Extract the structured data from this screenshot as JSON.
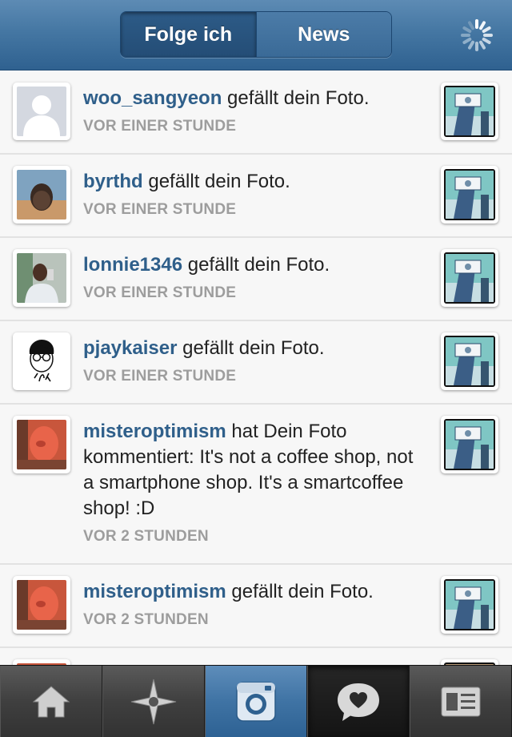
{
  "header": {
    "tabs": [
      {
        "label": "Folge ich",
        "active": true
      },
      {
        "label": "News",
        "active": false
      }
    ],
    "loading_icon": "spinner-icon"
  },
  "activities": [
    {
      "username": "woo_sangyeon",
      "text": " gefällt dein Foto.",
      "time": "VOR EINER STUNDE",
      "avatar": "default-avatar"
    },
    {
      "username": "byrthd",
      "text": " gefällt dein Foto.",
      "time": "VOR EINER STUNDE",
      "avatar": "photo"
    },
    {
      "username": "lonnie1346",
      "text": " gefällt dein Foto.",
      "time": "VOR EINER STUNDE",
      "avatar": "photo"
    },
    {
      "username": "pjaykaiser",
      "text": " gefällt dein Foto.",
      "time": "VOR EINER STUNDE",
      "avatar": "drawing"
    },
    {
      "username": "misteroptimism",
      "text": " hat Dein Foto kommentiert: It's not a coffee shop, not a smartphone shop. It's a smartcoffee shop! :D",
      "time": "VOR 2 STUNDEN",
      "avatar": "photo"
    },
    {
      "username": "misteroptimism",
      "text": " gefällt dein Foto.",
      "time": "VOR 2 STUNDEN",
      "avatar": "photo"
    }
  ],
  "tabbar": {
    "items": [
      {
        "icon": "home-icon"
      },
      {
        "icon": "explore-star-icon"
      },
      {
        "icon": "camera-icon"
      },
      {
        "icon": "activity-heart-bubble-icon"
      },
      {
        "icon": "profile-card-icon"
      }
    ]
  },
  "colors": {
    "header_blue": "#4577a3",
    "username_blue": "#2f5f8a",
    "timestamp_gray": "#9d9d9d"
  }
}
